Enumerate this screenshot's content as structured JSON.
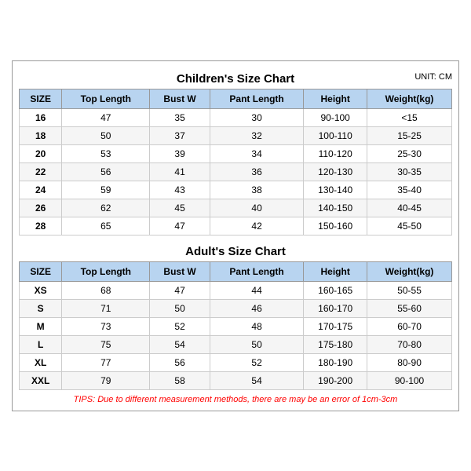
{
  "children_title": "Children's Size Chart",
  "adult_title": "Adult's Size Chart",
  "unit_label": "UNIT: CM",
  "children_headers": [
    "SIZE",
    "Top Length",
    "Bust W",
    "Pant Length",
    "Height",
    "Weight(kg)"
  ],
  "children_rows": [
    [
      "16",
      "47",
      "35",
      "30",
      "90-100",
      "<15"
    ],
    [
      "18",
      "50",
      "37",
      "32",
      "100-110",
      "15-25"
    ],
    [
      "20",
      "53",
      "39",
      "34",
      "110-120",
      "25-30"
    ],
    [
      "22",
      "56",
      "41",
      "36",
      "120-130",
      "30-35"
    ],
    [
      "24",
      "59",
      "43",
      "38",
      "130-140",
      "35-40"
    ],
    [
      "26",
      "62",
      "45",
      "40",
      "140-150",
      "40-45"
    ],
    [
      "28",
      "65",
      "47",
      "42",
      "150-160",
      "45-50"
    ]
  ],
  "adult_headers": [
    "SIZE",
    "Top Length",
    "Bust W",
    "Pant Length",
    "Height",
    "Weight(kg)"
  ],
  "adult_rows": [
    [
      "XS",
      "68",
      "47",
      "44",
      "160-165",
      "50-55"
    ],
    [
      "S",
      "71",
      "50",
      "46",
      "160-170",
      "55-60"
    ],
    [
      "M",
      "73",
      "52",
      "48",
      "170-175",
      "60-70"
    ],
    [
      "L",
      "75",
      "54",
      "50",
      "175-180",
      "70-80"
    ],
    [
      "XL",
      "77",
      "56",
      "52",
      "180-190",
      "80-90"
    ],
    [
      "XXL",
      "79",
      "58",
      "54",
      "190-200",
      "90-100"
    ]
  ],
  "tips": "TIPS: Due to different measurement methods, there are may be an error of 1cm-3cm"
}
